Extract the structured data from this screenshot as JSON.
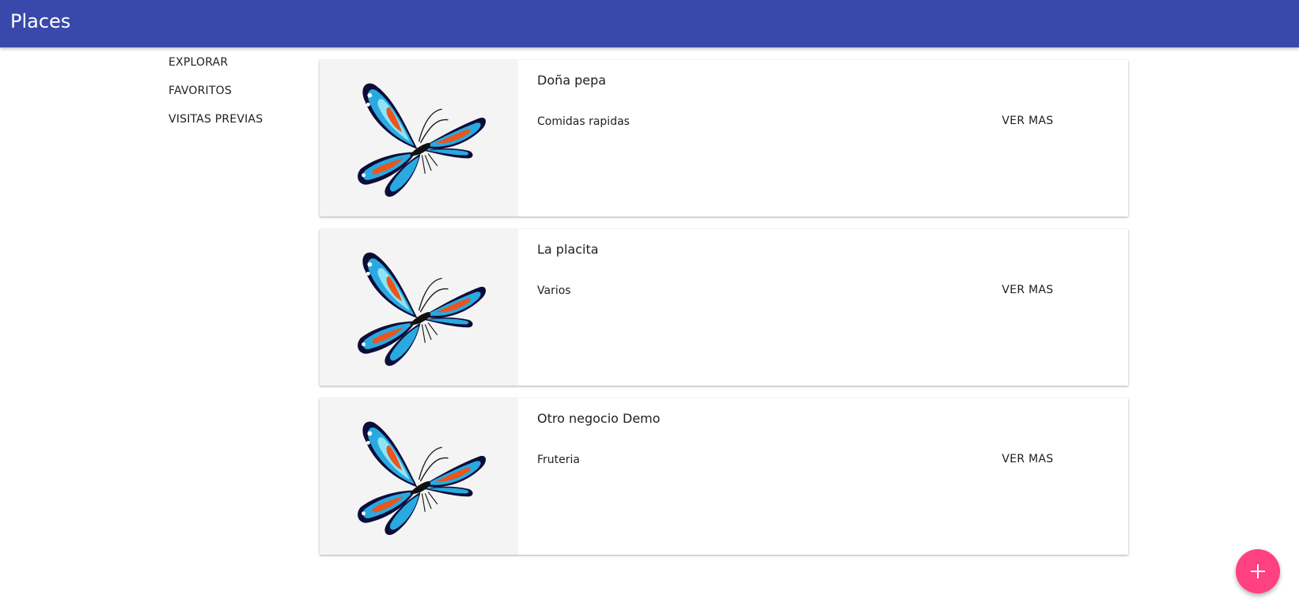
{
  "appbar": {
    "title": "Places",
    "color": "#3949ab"
  },
  "sidenav": {
    "items": [
      {
        "label": "EXPLORAR"
      },
      {
        "label": "FAVORITOS"
      },
      {
        "label": "VISITAS PREVIAS"
      }
    ]
  },
  "places": [
    {
      "name": "Doña pepa",
      "category": "Comidas rapidas",
      "action": "VER MAS",
      "image_icon": "butterfly-icon"
    },
    {
      "name": "La placita",
      "category": "Varios",
      "action": "VER MAS",
      "image_icon": "butterfly-icon"
    },
    {
      "name": "Otro negocio Demo",
      "category": "Fruteria",
      "action": "VER MAS",
      "image_icon": "butterfly-icon"
    }
  ],
  "fab": {
    "icon": "plus-icon",
    "color": "#ff4081"
  }
}
